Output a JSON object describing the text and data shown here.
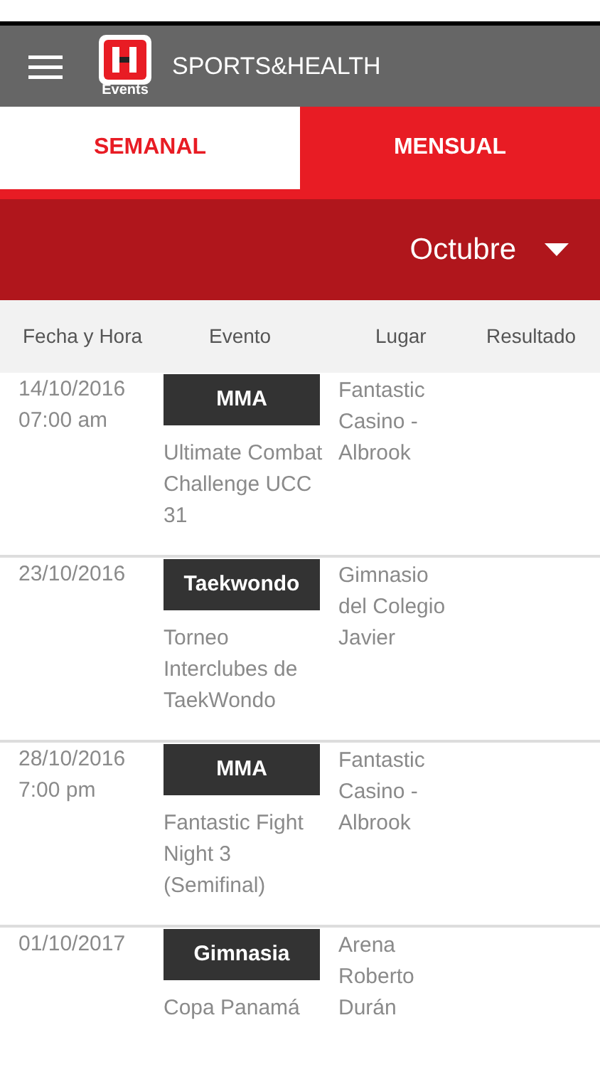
{
  "app_bar": {
    "title": "SPORTS&HEALTH",
    "logo_caption": "Events"
  },
  "tabs": [
    {
      "label": "SEMANAL",
      "selected": false
    },
    {
      "label": "MENSUAL",
      "selected": true
    }
  ],
  "month_picker": {
    "value": "Octubre"
  },
  "table": {
    "columns": [
      "Fecha y Hora",
      "Evento",
      "Lugar",
      "Resultado"
    ],
    "rows": [
      {
        "date": [
          "14/10/2016",
          "07:00 am"
        ],
        "sport": "MMA",
        "event": "Ultimate Combat Challenge UCC 31",
        "venue": "Fantastic Casino - Albrook"
      },
      {
        "date": [
          "23/10/2016"
        ],
        "sport": "Taekwondo",
        "event": "Torneo Interclubes de TaekWondo",
        "venue": "Gimnasio del Colegio Javier"
      },
      {
        "date": [
          "28/10/2016",
          "7:00 pm"
        ],
        "sport": "MMA",
        "event": "Fantastic Fight Night 3 (Semifinal)",
        "venue": "Fantastic Casino - Albrook"
      },
      {
        "date": [
          "01/10/2017"
        ],
        "sport": "Gimnasia",
        "event": "Copa Panamá",
        "venue": "Arena Roberto Durán"
      }
    ]
  }
}
